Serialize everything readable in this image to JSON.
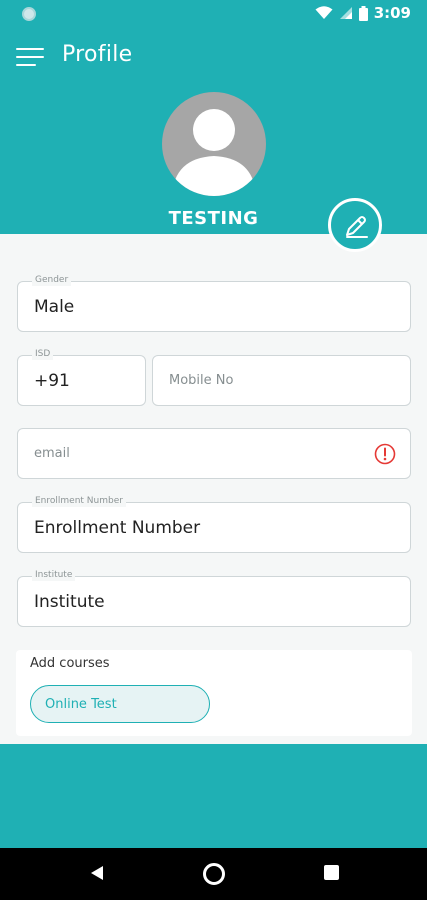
{
  "status_bar": {
    "time": "3:09"
  },
  "app_bar": {
    "title": "Profile"
  },
  "profile": {
    "username": "TESTING"
  },
  "form": {
    "gender": {
      "label": "Gender",
      "value": "Male"
    },
    "isd": {
      "label": "ISD",
      "value": "+91"
    },
    "mobile": {
      "placeholder": "Mobile No"
    },
    "email": {
      "placeholder": "email"
    },
    "enrollment": {
      "label": "Enrollment Number",
      "value": "Enrollment Number"
    },
    "institute": {
      "label": "Institute",
      "value": "Institute"
    }
  },
  "courses": {
    "title": "Add courses",
    "items": [
      {
        "label": "Online Test"
      }
    ]
  },
  "colors": {
    "accent": "#1fb0b4",
    "error": "#e53935",
    "chip_bg": "#e6f3f4"
  },
  "icons": [
    "menu-icon",
    "edit-icon",
    "error-icon",
    "wifi-icon",
    "signal-icon",
    "battery-icon",
    "back-icon",
    "home-icon",
    "recents-icon"
  ]
}
